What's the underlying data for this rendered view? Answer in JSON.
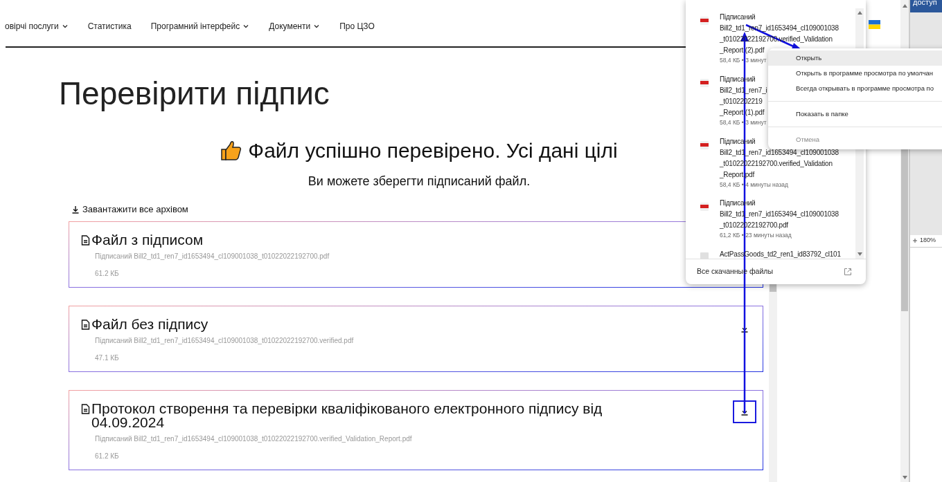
{
  "nav": [
    {
      "label": "овірчі послуги",
      "dropdown": true
    },
    {
      "label": "Статистика",
      "dropdown": false
    },
    {
      "label": "Програмний інтерфейс",
      "dropdown": true
    },
    {
      "label": "Документи",
      "dropdown": true
    },
    {
      "label": "Про ЦЗО",
      "dropdown": false
    }
  ],
  "title": "Перевірити підпис",
  "result": {
    "heading": "Файл успішно перевірено. Усі дані цілі",
    "subtitle": "Ви можете зберегти підписаний файл."
  },
  "download_all": "Завантажити все архівом",
  "files": [
    {
      "title": "Файл з підписом",
      "filename": "Підписаний Bill2_td1_ren7_id1653494_cl109001038_t01022022192700.pdf",
      "size": "61.2 КБ"
    },
    {
      "title": "Файл без підпису",
      "filename": "Підписаний Bill2_td1_ren7_id1653494_cl109001038_t01022022192700.verified.pdf",
      "size": "47.1 КБ",
      "download_button": true,
      "highlighted": false
    },
    {
      "title": "Протокол створення та перевірки кваліфікованого електронного підпису від 04.09.2024",
      "filename": "Підписаний Bill2_td1_ren7_id1653494_cl109001038_t01022022192700.verified_Validation_Report.pdf",
      "size": "61.2 КБ",
      "download_button": true,
      "highlighted": true
    }
  ],
  "downloads": {
    "items": [
      {
        "lines": [
          "Підписаний",
          "Bill2_td1_ren7_id1653494_cl109001038",
          "_t01022022192700.verified_Validation",
          "_Report (2).pdf"
        ],
        "meta": "58,4 КБ • 3 минут",
        "kind": "pdf"
      },
      {
        "lines": [
          "Підписаний",
          "Bill2_td1_ren7_i",
          "_t0102202219",
          "_Report (1).pdf"
        ],
        "meta": "58,4 КБ • 3 минут",
        "kind": "pdf"
      },
      {
        "lines": [
          "Підписаний",
          "Bill2_td1_ren7_id1653494_cl109001038",
          "_t01022022192700.verified_Validation",
          "_Report.pdf"
        ],
        "meta": "58,4 КБ • 4 минуты назад",
        "kind": "pdf"
      },
      {
        "lines": [
          "Підписаний",
          "Bill2_td1_ren7_id1653494_cl109001038",
          "_t01022022192700.pdf"
        ],
        "meta": "61,2 КБ • 23 минуты назад",
        "kind": "pdf"
      },
      {
        "lines": [
          "ActPassGoods_td2_ren1_id83792_cl101"
        ],
        "kind": "file"
      }
    ],
    "footer": "Все скачанные файлы"
  },
  "context_menu": [
    {
      "label": "Открыть",
      "selected": true,
      "disabled": false
    },
    {
      "label": "Открыть в программе просмотра по умолчан",
      "selected": false,
      "disabled": false
    },
    {
      "label": "Всегда открывать в программе просмотра по",
      "selected": false,
      "disabled": false,
      "divider_after": true
    },
    {
      "label": "Показать в папке",
      "selected": false,
      "disabled": false,
      "divider_after": true
    },
    {
      "label": "Отмена",
      "selected": false,
      "disabled": true
    }
  ],
  "side_window": {
    "header": "доступ",
    "zoom": "180%"
  }
}
